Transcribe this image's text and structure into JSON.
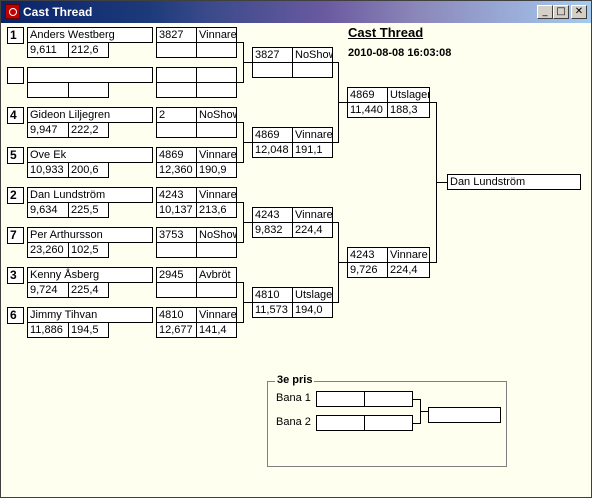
{
  "window": {
    "title": "Cast Thread"
  },
  "header": {
    "title": "Cast Thread",
    "datetime": "2010-08-08 16:03:08"
  },
  "round1": [
    {
      "seed": "1",
      "name": "Anders Westberg",
      "v1": "9,611",
      "v2": "212,6",
      "id": "3827",
      "status": "Vinnare",
      "s1": "",
      "s2": ""
    },
    {
      "seed": "",
      "name": "",
      "v1": "",
      "v2": "",
      "id": "",
      "status": "",
      "s1": "",
      "s2": ""
    },
    {
      "seed": "4",
      "name": "Gideon Liljegren",
      "v1": "9,947",
      "v2": "222,2",
      "id": "2",
      "status": "NoShow",
      "s1": "",
      "s2": ""
    },
    {
      "seed": "5",
      "name": "Ove Ek",
      "v1": "10,933",
      "v2": "200,6",
      "id": "4869",
      "status": "Vinnare",
      "s1": "12,360",
      "s2": "190,9"
    },
    {
      "seed": "2",
      "name": "Dan Lundström",
      "v1": "9,634",
      "v2": "225,5",
      "id": "4243",
      "status": "Vinnare",
      "s1": "10,137",
      "s2": "213,6"
    },
    {
      "seed": "7",
      "name": "Per Arthursson",
      "v1": "23,260",
      "v2": "102,5",
      "id": "3753",
      "status": "NoShow",
      "s1": "",
      "s2": ""
    },
    {
      "seed": "3",
      "name": "Kenny Åsberg",
      "v1": "9,724",
      "v2": "225,4",
      "id": "2945",
      "status": "Avbröt",
      "s1": "",
      "s2": ""
    },
    {
      "seed": "6",
      "name": "Jimmy Tihvan",
      "v1": "11,886",
      "v2": "194,5",
      "id": "4810",
      "status": "Vinnare",
      "s1": "12,677",
      "s2": "141,4"
    }
  ],
  "round2": [
    {
      "id": "3827",
      "status": "NoShow",
      "s1": "",
      "s2": ""
    },
    {
      "id": "4869",
      "status": "Vinnare",
      "s1": "12,048",
      "s2": "191,1"
    },
    {
      "id": "4243",
      "status": "Vinnare",
      "s1": "9,832",
      "s2": "224,4"
    },
    {
      "id": "4810",
      "status": "Utslagen",
      "s1": "11,573",
      "s2": "194,0"
    }
  ],
  "round3": [
    {
      "id": "4869",
      "status": "Utslagen",
      "s1": "11,440",
      "s2": "188,3"
    },
    {
      "id": "4243",
      "status": "Vinnare",
      "s1": "9,726",
      "s2": "224,4"
    }
  ],
  "winner": {
    "name": "Dan Lundström"
  },
  "third_place": {
    "title": "3e pris",
    "lane1": "Bana 1",
    "lane2": "Bana 2"
  }
}
